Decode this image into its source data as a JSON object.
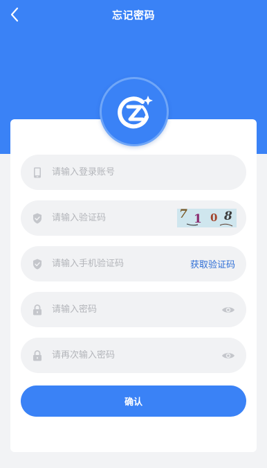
{
  "header": {
    "title": "忘记密码",
    "back_icon": "chevron-left-icon"
  },
  "logo": {
    "icon": "brand-logo"
  },
  "form": {
    "account": {
      "placeholder": "请输入登录账号",
      "icon": "phone-icon"
    },
    "captcha": {
      "placeholder": "请输入验证码",
      "icon": "shield-icon",
      "image_chars": [
        "7",
        "1",
        "0",
        "8"
      ]
    },
    "sms_code": {
      "placeholder": "请输入手机验证码",
      "icon": "shield-icon",
      "get_code_label": "获取验证码"
    },
    "password": {
      "placeholder": "请输入密码",
      "icon": "lock-icon",
      "toggle_icon": "eye-icon"
    },
    "confirm_password": {
      "placeholder": "请再次输入密码",
      "icon": "lock-icon",
      "toggle_icon": "eye-icon"
    }
  },
  "confirm_button": {
    "label": "确认"
  },
  "colors": {
    "primary": "#3a82f6",
    "link": "#2f6fd6",
    "field_bg": "#f1f2f4",
    "placeholder": "#b3b5ba",
    "page_bg": "#f2f3f5"
  }
}
